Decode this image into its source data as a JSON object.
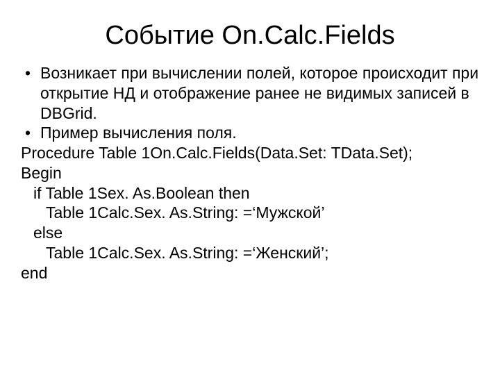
{
  "title": "Событие On.Calc.Fields",
  "bullets": [
    "Возникает при вычислении полей, которое происходит при открытие НД и отображение ранее не видимых записей в DBGrid.",
    "Пример вычисления поля."
  ],
  "code": {
    "line1": "Procedure Table 1On.Calc.Fields(Data.Set: TData.Set);",
    "line2": "Begin",
    "line3": "if Table 1Sex. As.Boolean then",
    "line4": "Table 1Calc.Sex. As.String: =‘Мужской’",
    "line5": "else",
    "line6": "Table 1Calc.Sex. As.String: =‘Женский’;",
    "line7": "end"
  }
}
